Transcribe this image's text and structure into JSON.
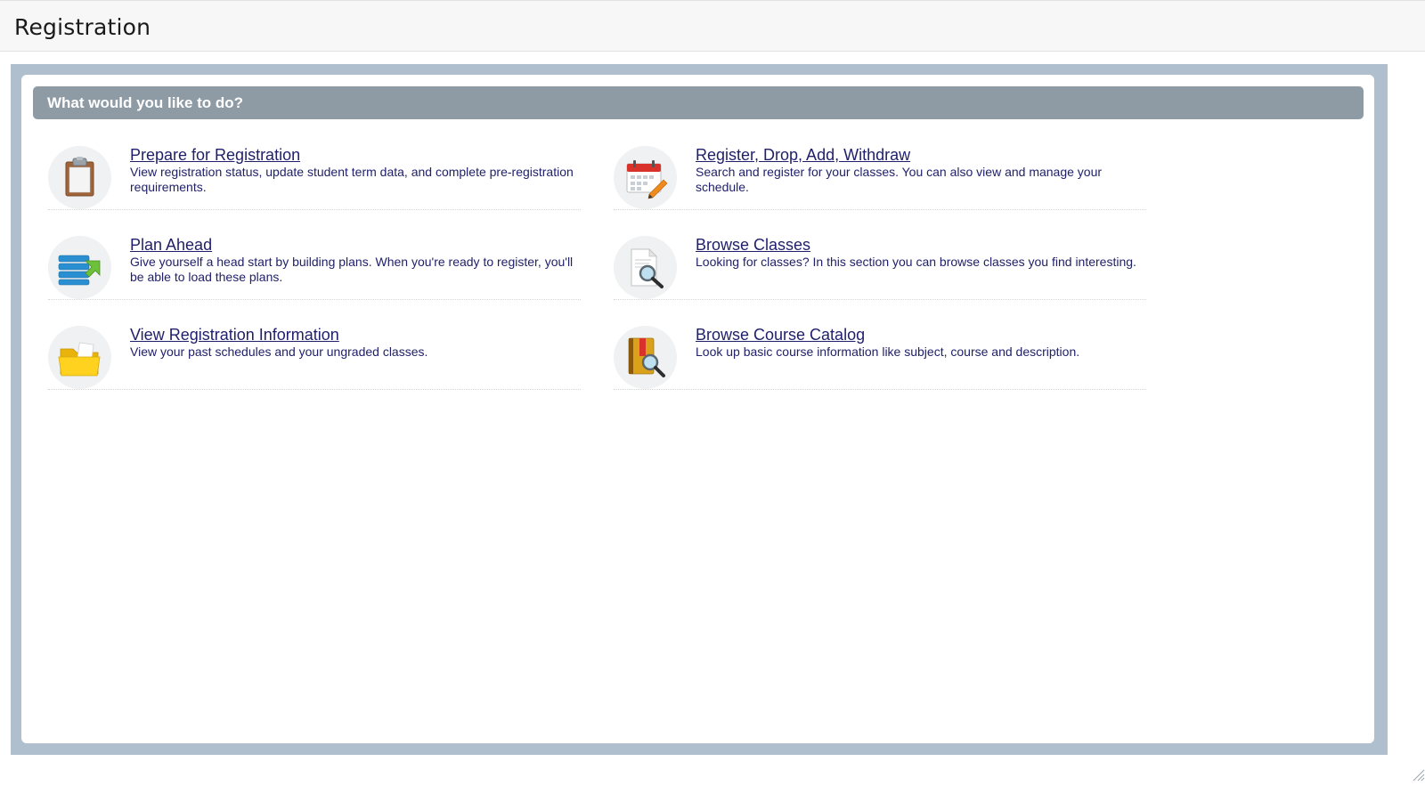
{
  "header": {
    "title": "Registration"
  },
  "panel": {
    "heading": "What would you like to do?"
  },
  "actions": [
    {
      "label": "Prepare for Registration",
      "description": "View registration status, update student term data, and complete pre-registration requirements.",
      "icon": "clipboard-icon"
    },
    {
      "label": "Register, Drop, Add, Withdraw",
      "description": "Search and register for your classes. You can also view and manage your schedule.",
      "icon": "calendar-edit-icon"
    },
    {
      "label": "Plan Ahead",
      "description": "Give yourself a head start by building plans. When you're ready to register, you'll be able to load these plans.",
      "icon": "plan-list-icon"
    },
    {
      "label": "Browse Classes",
      "description": "Looking for classes? In this section you can browse classes you find interesting.",
      "icon": "document-search-icon"
    },
    {
      "label": "View Registration Information",
      "description": "View your past schedules and your ungraded classes.",
      "icon": "folder-icon"
    },
    {
      "label": "Browse Course Catalog",
      "description": "Look up basic course information like subject, course and description.",
      "icon": "book-search-icon"
    }
  ],
  "colors": {
    "header_bg": "#f7f7f7",
    "frame_bg": "#afbfce",
    "panel_heading_bg": "#8e9ba5",
    "link": "#1f1f6b"
  }
}
